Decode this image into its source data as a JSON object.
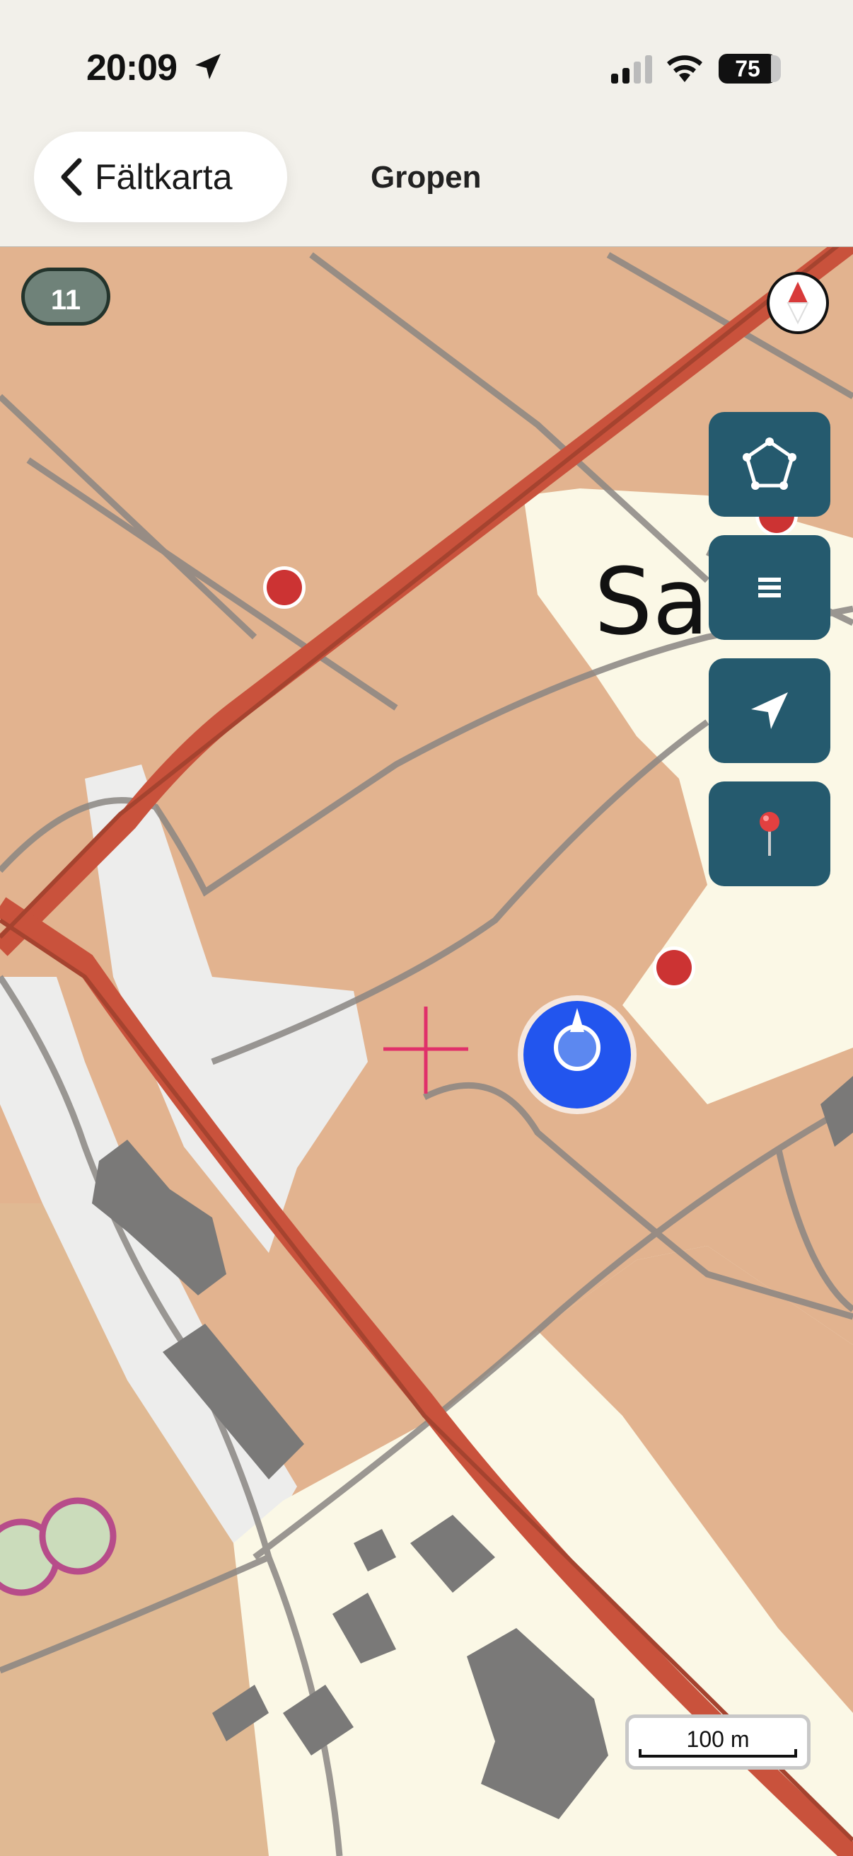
{
  "status_bar": {
    "time": "20:09",
    "battery": "75"
  },
  "nav": {
    "back_label": "Fältkarta",
    "title": "Gropen"
  },
  "map": {
    "zoom_level": "11",
    "scale_label": "100 m",
    "place_label": "Sa"
  },
  "colors": {
    "toolbar_button": "#255a6e",
    "user_location": "#2255ee",
    "marker": "#cc3333",
    "crosshair": "#e0306a"
  },
  "icons": [
    "location-arrow-icon",
    "signal-icon",
    "wifi-icon",
    "battery-icon",
    "chevron-left-icon",
    "compass-icon",
    "polygon-icon",
    "layers-icon",
    "navigate-icon",
    "pin-icon"
  ]
}
